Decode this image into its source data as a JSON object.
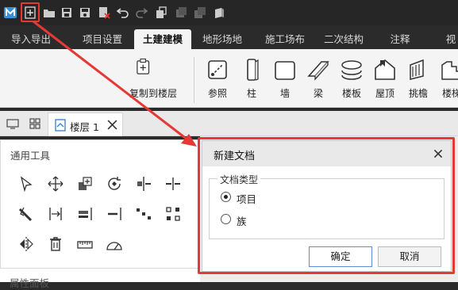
{
  "toolbar": {
    "icons": [
      "app-logo-icon",
      "new-document-icon",
      "open-folder-icon",
      "save-icon",
      "save-as-icon",
      "close-document-icon",
      "undo-icon",
      "redo-icon",
      "copy-icon",
      "layer-icon",
      "stack-icon",
      "cube-icon"
    ]
  },
  "ribbon_tabs": [
    {
      "label": "导入导出",
      "active": false
    },
    {
      "label": "项目设置",
      "active": false
    },
    {
      "label": "土建建模",
      "active": true
    },
    {
      "label": "地形场地",
      "active": false
    },
    {
      "label": "施工场布",
      "active": false
    },
    {
      "label": "二次结构",
      "active": false
    },
    {
      "label": "注释",
      "active": false
    },
    {
      "label": "视",
      "active": false
    }
  ],
  "ribbon": {
    "copy_to_floor": "复制到楼层",
    "items": [
      "参照",
      "柱",
      "墙",
      "梁",
      "楼板",
      "屋顶",
      "挑檐",
      "楼梯"
    ]
  },
  "doc_tab": {
    "name": "楼层 1"
  },
  "left_panel": {
    "title": "通用工具",
    "tools": [
      "select-arrow-icon",
      "move-icon",
      "copy-add-icon",
      "rotate-icon",
      "align-icon",
      "split-icon",
      "trim-icon",
      "offset-icon",
      "extend-left-icon",
      "extend-right-icon",
      "array-icon",
      "grid-array-icon",
      "mirror-icon",
      "delete-icon",
      "measure-icon",
      "angle-icon"
    ],
    "panel2_title": "属性面板"
  },
  "dialog": {
    "title": "新建文档",
    "group_label": "文档类型",
    "options": [
      {
        "label": "项目",
        "checked": true
      },
      {
        "label": "族",
        "checked": false
      }
    ],
    "ok_label": "确定",
    "cancel_label": "取消"
  },
  "colors": {
    "annotation": "#e53935",
    "toolbar_bg": "#262626",
    "ribbon_bg": "#f4f4f4",
    "logo": "#3b8fd9"
  }
}
